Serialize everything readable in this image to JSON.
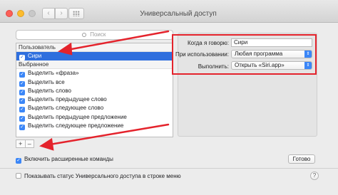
{
  "window": {
    "title": "Универсальный доступ",
    "nav_back": "‹",
    "nav_forward": "›"
  },
  "search": {
    "placeholder": "Поиск"
  },
  "list": {
    "group_user": "Пользователь",
    "user_items": [
      {
        "label": "Сири",
        "checked": true,
        "selected": true
      }
    ],
    "group_favorites": "Выбранное",
    "favorite_items": [
      {
        "label": "Выделить «фраза»",
        "checked": true
      },
      {
        "label": "Выделить все",
        "checked": true
      },
      {
        "label": "Выделить слово",
        "checked": true
      },
      {
        "label": "Выделить предыдущее слово",
        "checked": true
      },
      {
        "label": "Выделить следующее слово",
        "checked": true
      },
      {
        "label": "Выделить предыдущее предложение",
        "checked": true
      },
      {
        "label": "Выделить следующее предложение",
        "checked": true
      }
    ]
  },
  "list_controls": {
    "add": "+",
    "remove": "–"
  },
  "form": {
    "when_i_say_label": "Когда я говорю:",
    "when_i_say_value": "Сири",
    "while_using_label": "При использовании:",
    "while_using_value": "Любая программа",
    "perform_label": "Выполнить:",
    "perform_value": "Открыть «Siri.app»"
  },
  "advanced": {
    "label": "Включить расширенные команды",
    "checked": true
  },
  "done_button": "Готово",
  "footer": {
    "status_label": "Показывать статус Универсального доступа в строке меню",
    "checked": false,
    "help": "?"
  },
  "annotation_color": "#e4232c",
  "accent_color": "#3b86f7"
}
